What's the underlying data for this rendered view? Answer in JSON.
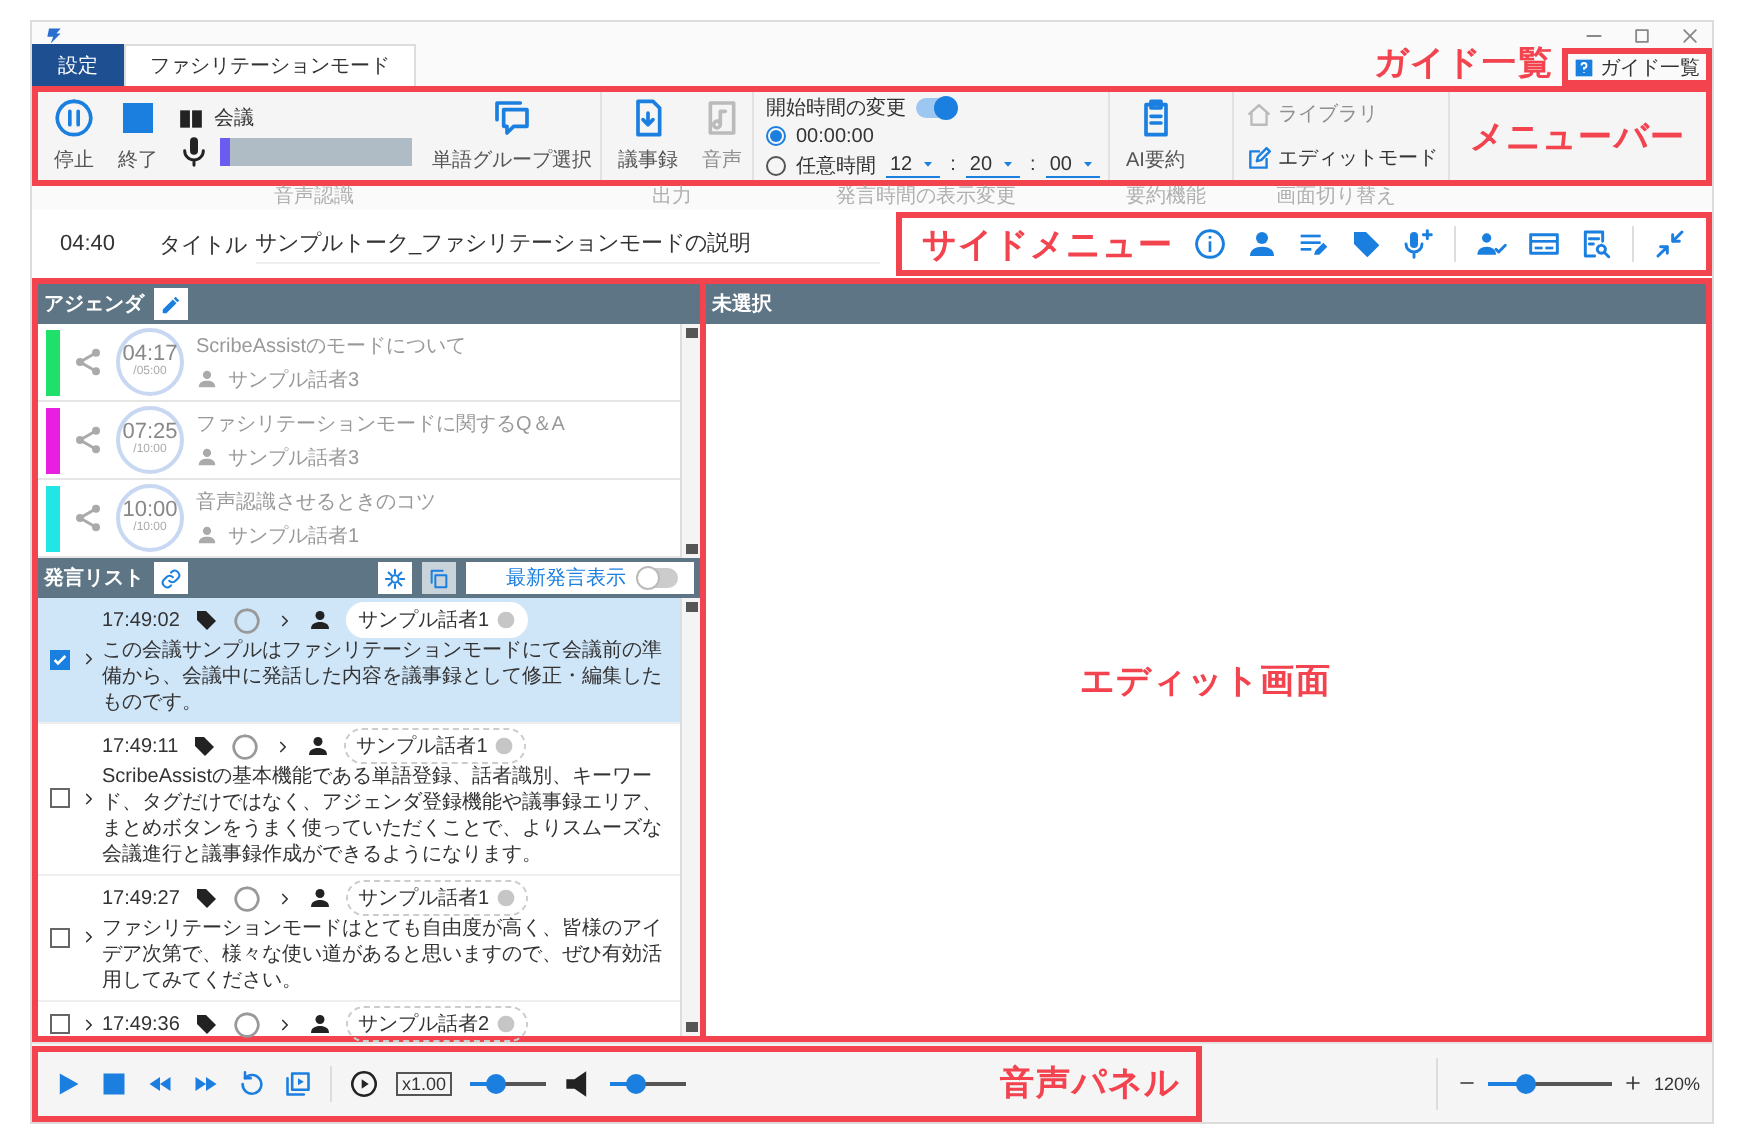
{
  "tabs": [
    {
      "label": "設定",
      "kind": "file",
      "selected": false
    },
    {
      "label": "ファシリテーションモード",
      "kind": "tab",
      "selected": true
    }
  ],
  "guide_button": {
    "label": "ガイド一覧"
  },
  "annotations": {
    "guide": "ガイド一覧",
    "menu_bar": "メニューバー",
    "side_menu": "サイドメニュー",
    "editor": "エディット画面",
    "audio_panel": "音声パネル"
  },
  "ribbon": {
    "groups": [
      {
        "label": "音声認識",
        "items": [
          {
            "kind": "big",
            "label": "停止",
            "disabled": false
          },
          {
            "kind": "big",
            "label": "終了",
            "disabled": false
          },
          {
            "kind": "meter",
            "mode": "会議",
            "level": 0.05
          },
          {
            "kind": "big",
            "label": "単語グループ選択",
            "disabled": false
          }
        ]
      },
      {
        "label": "出力",
        "items": [
          {
            "kind": "big",
            "label": "議事録",
            "disabled": false
          },
          {
            "kind": "big",
            "label": "音声",
            "disabled": true
          }
        ]
      },
      {
        "label": "発言時間の表示変更",
        "items": [
          {
            "kind": "time",
            "title": "開始時間の変更",
            "on": true,
            "options": [
              {
                "label": "00:00:00",
                "selected": true
              },
              {
                "label": "任意時間",
                "selected": false
              }
            ],
            "time": [
              "12",
              "20",
              "00"
            ],
            "separator": ":"
          }
        ]
      },
      {
        "label": "要約機能",
        "items": [
          {
            "kind": "big",
            "label": "AI要約",
            "disabled": false
          }
        ]
      },
      {
        "label": "画面切り替え",
        "items": [
          {
            "kind": "small",
            "label": "ライブラリ",
            "disabled": true
          },
          {
            "kind": "small",
            "label": "エディットモード",
            "disabled": false
          }
        ]
      }
    ]
  },
  "title_bar": {
    "elapsed": "04:40",
    "label": "タイトル",
    "title": "サンプルトーク_ファシリテーションモードの説明"
  },
  "agenda": {
    "title": "アジェンダ",
    "items": [
      {
        "color": "#1fe06a",
        "time": "04:17",
        "limit": "/05:00",
        "title": "ScribeAssistのモードについて",
        "speaker": "サンプル話者3"
      },
      {
        "color": "#e81ee0",
        "time": "07:25",
        "limit": "/10:00",
        "title": "ファシリテーションモードに関するQ＆A",
        "speaker": "サンプル話者3"
      },
      {
        "color": "#22e5e5",
        "time": "10:00",
        "limit": "/10:00",
        "title": "音声認識させるときのコツ",
        "speaker": "サンプル話者1"
      }
    ]
  },
  "speech_list": {
    "title": "発言リスト",
    "latest_toggle": {
      "label": "最新発言表示",
      "on": false
    },
    "rows": [
      {
        "time": "17:49:02",
        "speaker": "サンプル話者1",
        "checked": true,
        "selected": true,
        "text": "この会議サンプルはファシリテーションモードにて会議前の準備から、会議中に発話した内容を議事録として修正・編集したものです。"
      },
      {
        "time": "17:49:11",
        "speaker": "サンプル話者1",
        "checked": false,
        "selected": false,
        "text": "ScribeAssistの基本機能である単語登録、話者識別、キーワード、タグだけではなく、アジェンダ登録機能や議事録エリア、まとめボタンをうまく使っていただくことで、よりスムーズな会議進行と議事録作成ができるようになります。"
      },
      {
        "time": "17:49:27",
        "speaker": "サンプル話者1",
        "checked": false,
        "selected": false,
        "text": "ファシリテーションモードはとても自由度が高く、皆様のアイデア次第で、様々な使い道があると思いますので、ぜひ有効活用してみてください。"
      },
      {
        "time": "17:49:36",
        "speaker": "サンプル話者2",
        "checked": false,
        "selected": false
      }
    ]
  },
  "editor": {
    "header": "未選択"
  },
  "audio": {
    "speed": "x1.00",
    "speed_slider": {
      "level": 0.35
    },
    "volume_slider": {
      "level": 0.35
    },
    "zoom_slider": {
      "level": 0.3
    },
    "zoom": "120%"
  }
}
